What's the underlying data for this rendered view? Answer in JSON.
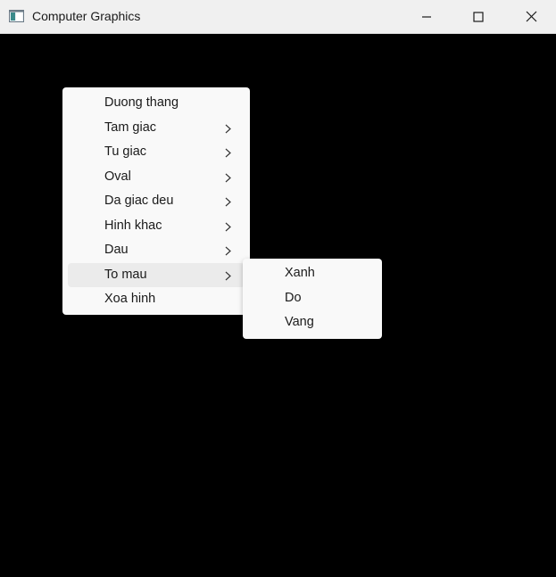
{
  "window": {
    "title": "Computer Graphics",
    "icon": "app-window-icon",
    "controls": [
      "minimize-icon",
      "maximize-icon",
      "close-icon"
    ]
  },
  "context_menu": {
    "items": [
      {
        "label": "Duong thang",
        "has_submenu": false
      },
      {
        "label": "Tam giac",
        "has_submenu": true
      },
      {
        "label": "Tu giac",
        "has_submenu": true
      },
      {
        "label": "Oval",
        "has_submenu": true
      },
      {
        "label": "Da giac deu",
        "has_submenu": true
      },
      {
        "label": "Hinh khac",
        "has_submenu": true
      },
      {
        "label": "Dau",
        "has_submenu": true
      },
      {
        "label": "To mau",
        "has_submenu": true,
        "highlighted": true
      },
      {
        "label": "Xoa hinh",
        "has_submenu": false
      }
    ]
  },
  "submenu": {
    "parent": "To mau",
    "items": [
      {
        "label": "Xanh"
      },
      {
        "label": "Do"
      },
      {
        "label": "Vang"
      }
    ]
  },
  "colors": {
    "canvas": "#000000",
    "titlebar": "#f0f0f0",
    "menu_bg": "#f9f9f9",
    "menu_highlight": "#ebebeb"
  }
}
